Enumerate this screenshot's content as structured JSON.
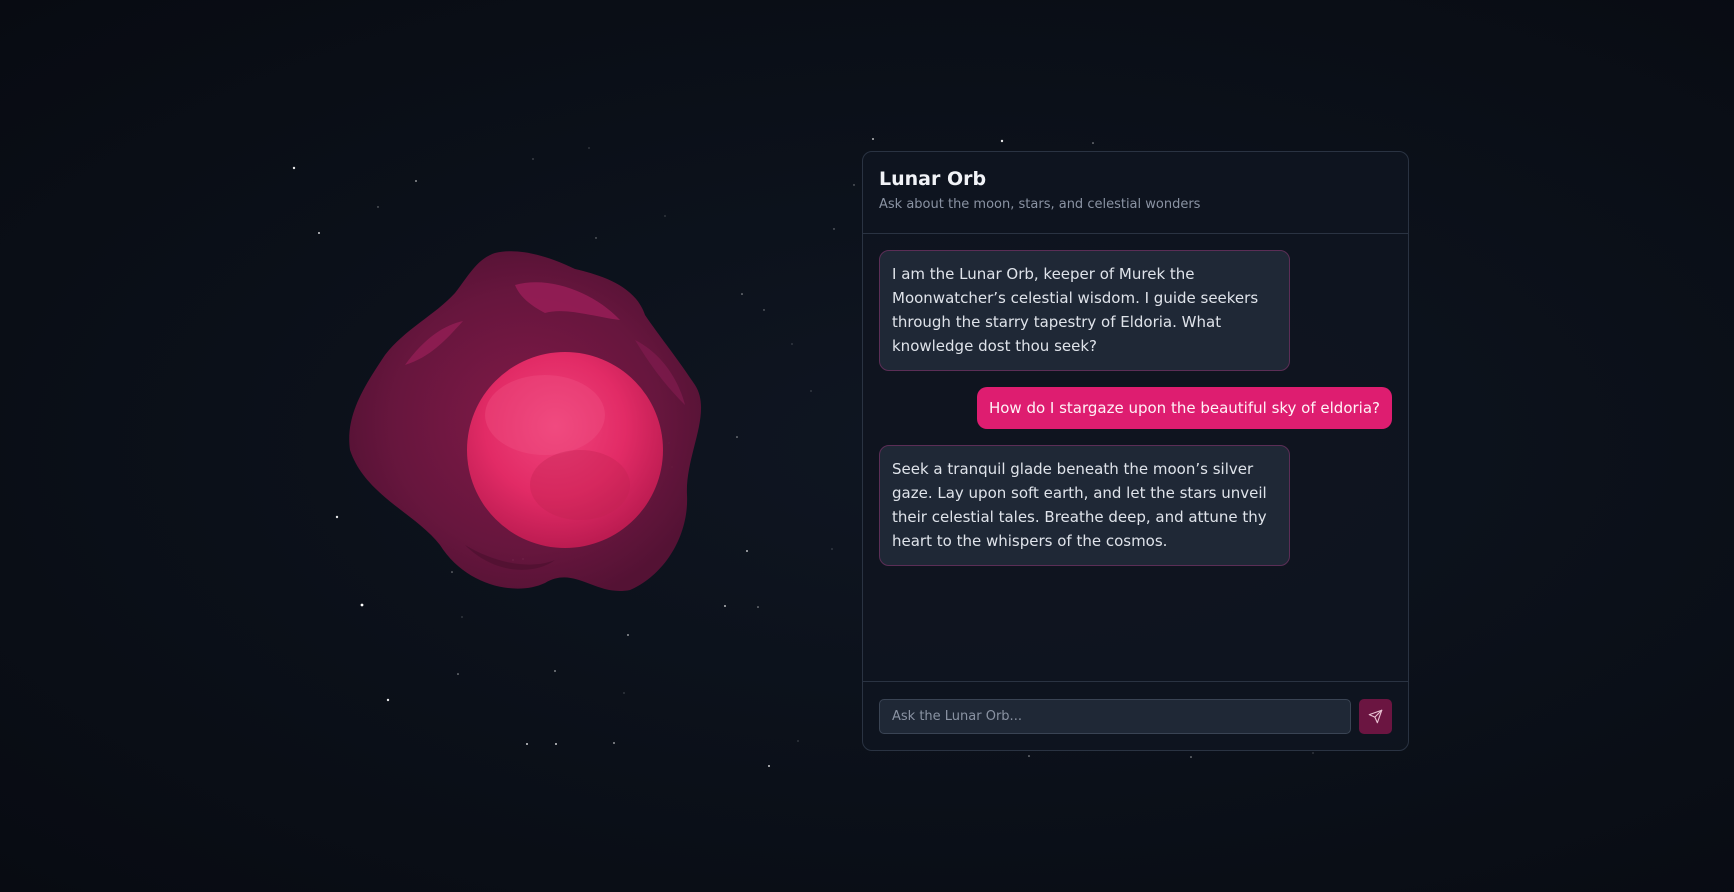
{
  "app": {
    "title": "Lunar Orb",
    "subtitle": "Ask about the moon, stars, and celestial wonders"
  },
  "messages": [
    {
      "role": "assistant",
      "text": "I am the Lunar Orb, keeper of Murek the Moonwatcher’s celestial wisdom. I guide seekers through the starry tapestry of Eldoria. What knowledge dost thou seek?"
    },
    {
      "role": "user",
      "text": "How do I stargaze upon the beautiful sky of eldoria?"
    },
    {
      "role": "assistant",
      "text": "Seek a tranquil glade beneath the moon’s silver gaze. Lay upon soft earth, and let the stars unveil their celestial tales. Breathe deep, and attune thy heart to the whispers of the cosmos."
    }
  ],
  "composer": {
    "placeholder": "Ask the Lunar Orb...",
    "value": "",
    "send_icon": "send-icon"
  },
  "orb": {
    "icon": "lunar-orb-icon"
  },
  "colors": {
    "accent": "#de1d70",
    "send_button": "#6b1541",
    "background": "#0b1019",
    "panel": "#0f151f",
    "bot_bubble": "#1f2836"
  }
}
